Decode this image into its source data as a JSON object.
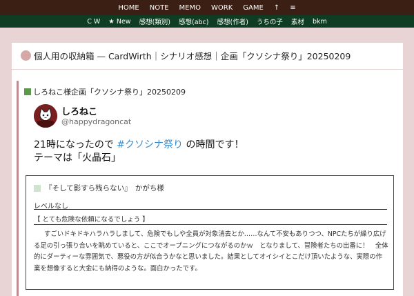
{
  "topnav": {
    "items": [
      "HOME",
      "NOTE",
      "MEMO",
      "WORK",
      "GAME",
      "↑",
      "≡"
    ]
  },
  "subnav": {
    "items": [
      "C W",
      "★ New",
      "感想(類別)",
      "感想(abc)",
      "感想(作者)",
      "うちの子",
      "素材",
      "bkm"
    ]
  },
  "page": {
    "title": "個人用の収納箱 — CardWirth｜シナリオ感想｜企画「クソシナ祭り」20250209"
  },
  "article": {
    "subheading": "しろねこ様企画「クソシナ祭り」20250209",
    "tweet": {
      "name": "しろねこ",
      "handle": "@happydragoncat",
      "line1_before": "21時になったので ",
      "hashtag": "#クソシナ祭り",
      "line1_after": " の時間です！",
      "line2": "テーマは「火晶石」"
    },
    "review": {
      "title": "『そして影すら残らない』　かがち様",
      "level": "レベルなし",
      "quote": "【 とても危険な依頼になるでしょう 】",
      "body": "すごいドキドキハラハラしまして、危険でもしや全員が対象消去とか……なんて不安もありつつ、NPCたちが繰り広げる足の引っ張り合いを眺めていると、ここでオープニングにつながるのかｗ　となりまして、冒険者たちの出番に！　全体的にダーティーな雰囲気で、悪役の方が似合うかなと思いました。結果としてオイシイとこだけ頂いたような、実際の作業を想像すると大金にも納得のような。面白かったです。"
    }
  },
  "colors": {
    "topnav_bg": "#3b1f14",
    "subnav_bg": "#0f3d23",
    "page_bg": "#e8d4d4",
    "accent_border": "#c08a92",
    "hashtag": "#3a8ed0"
  }
}
